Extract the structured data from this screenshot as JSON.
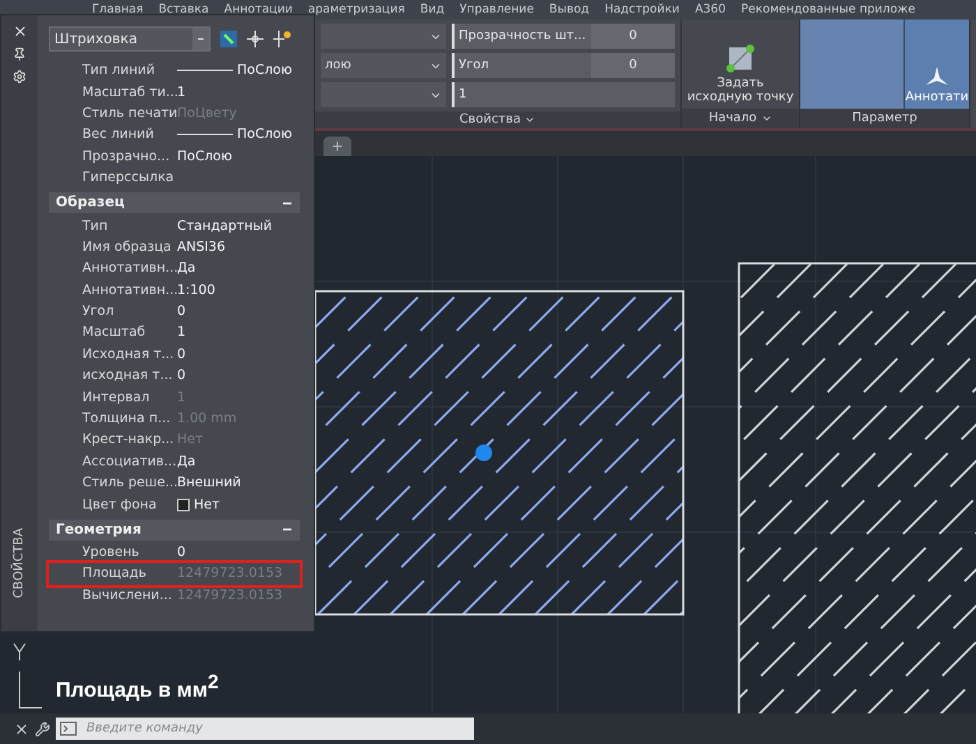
{
  "menu_tabs": [
    {
      "label": "Главная",
      "selected": false
    },
    {
      "label": "Вставка",
      "selected": false
    },
    {
      "label": "Аннотации",
      "selected": false
    },
    {
      "label": "араметризация",
      "selected": false
    },
    {
      "label": "Вид",
      "selected": false
    },
    {
      "label": "Управление",
      "selected": false
    },
    {
      "label": "Вывод",
      "selected": false
    },
    {
      "label": "Надстройки",
      "selected": false
    },
    {
      "label": "A360",
      "selected": false
    },
    {
      "label": "Рекомендованные приложе",
      "selected": false
    }
  ],
  "ribbon": {
    "properties_panel": {
      "layer_dropdown": "лою",
      "transparency_label": "Прозрачность шт...",
      "transparency_value": "0",
      "angle_label": "Угол",
      "angle_value": "0",
      "scale_value": "1",
      "title": "Свойства"
    },
    "origin_panel": {
      "button": "Задать исходную точку",
      "title": "Начало"
    },
    "options_panel": {
      "button": "Аннотати",
      "title": "Параметр"
    }
  },
  "properties": {
    "title": "СВОЙСТВА",
    "object_type": "Штриховка",
    "sections": [
      {
        "rows": [
          {
            "label": "Тип линий",
            "value": "ПоСлою",
            "kind": "line",
            "disabled": false,
            "highlighted": false
          },
          {
            "label": "Масштаб ти...",
            "value": "1",
            "kind": "text",
            "disabled": false,
            "highlighted": false
          },
          {
            "label": "Стиль печати",
            "value": "ПоЦвету",
            "kind": "text",
            "disabled": true,
            "highlighted": false
          },
          {
            "label": "Вес линий",
            "value": "ПоСлою",
            "kind": "line",
            "disabled": false,
            "highlighted": false
          },
          {
            "label": "Прозрачно...",
            "value": "ПоСлою",
            "kind": "text",
            "disabled": false,
            "highlighted": false
          },
          {
            "label": "Гиперссылка",
            "kind": "label",
            "highlighted": false
          }
        ]
      },
      {
        "title": "Образец",
        "expanded": true,
        "rows": [
          {
            "label": "Тип",
            "value": "Стандартный",
            "kind": "text",
            "disabled": false,
            "highlighted": false
          },
          {
            "label": "Имя образца",
            "value": "ANSI36",
            "kind": "text",
            "disabled": false,
            "highlighted": false
          },
          {
            "label": "Аннотативн...",
            "value": "Да",
            "kind": "text",
            "disabled": false,
            "highlighted": false
          },
          {
            "label": "Аннотативн...",
            "value": "1:100",
            "kind": "text",
            "disabled": false,
            "highlighted": false
          },
          {
            "label": "Угол",
            "value": "0",
            "kind": "text",
            "disabled": false,
            "highlighted": false
          },
          {
            "label": "Масштаб",
            "value": "1",
            "kind": "text",
            "disabled": false,
            "highlighted": false
          },
          {
            "label": "Исходная т...",
            "value": "0",
            "kind": "text",
            "disabled": false,
            "highlighted": false
          },
          {
            "label": "исходная т...",
            "value": "0",
            "kind": "text",
            "disabled": false,
            "highlighted": false
          },
          {
            "label": "Интервал",
            "value": "1",
            "kind": "text",
            "disabled": true,
            "highlighted": false
          },
          {
            "label": "Толщина п...",
            "value": "1.00 mm",
            "kind": "text",
            "disabled": true,
            "highlighted": false
          },
          {
            "label": "Крест-накр...",
            "value": "Нет",
            "kind": "text",
            "disabled": true,
            "highlighted": false
          },
          {
            "label": "Ассоциатив...",
            "value": "Да",
            "kind": "text",
            "disabled": false,
            "highlighted": false
          },
          {
            "label": "Стиль реше...",
            "value": "Внешний",
            "kind": "text",
            "disabled": false,
            "highlighted": false
          },
          {
            "label": "Цвет фона",
            "value": "Нет",
            "kind": "color",
            "disabled": false,
            "highlighted": false
          }
        ]
      },
      {
        "title": "Геометрия",
        "expanded": true,
        "rows": [
          {
            "label": "Уровень",
            "value": "0",
            "kind": "text",
            "disabled": false,
            "highlighted": false
          },
          {
            "label": "Площадь",
            "value": "12479723.0153",
            "kind": "text",
            "disabled": true,
            "highlighted": true
          },
          {
            "label": "Вычислени...",
            "value": "12479723.0153",
            "kind": "text",
            "disabled": true,
            "highlighted": false
          }
        ]
      }
    ]
  },
  "caption": "Площадь в мм$^{2}$",
  "command_line": {
    "placeholder": "Введите команду"
  }
}
